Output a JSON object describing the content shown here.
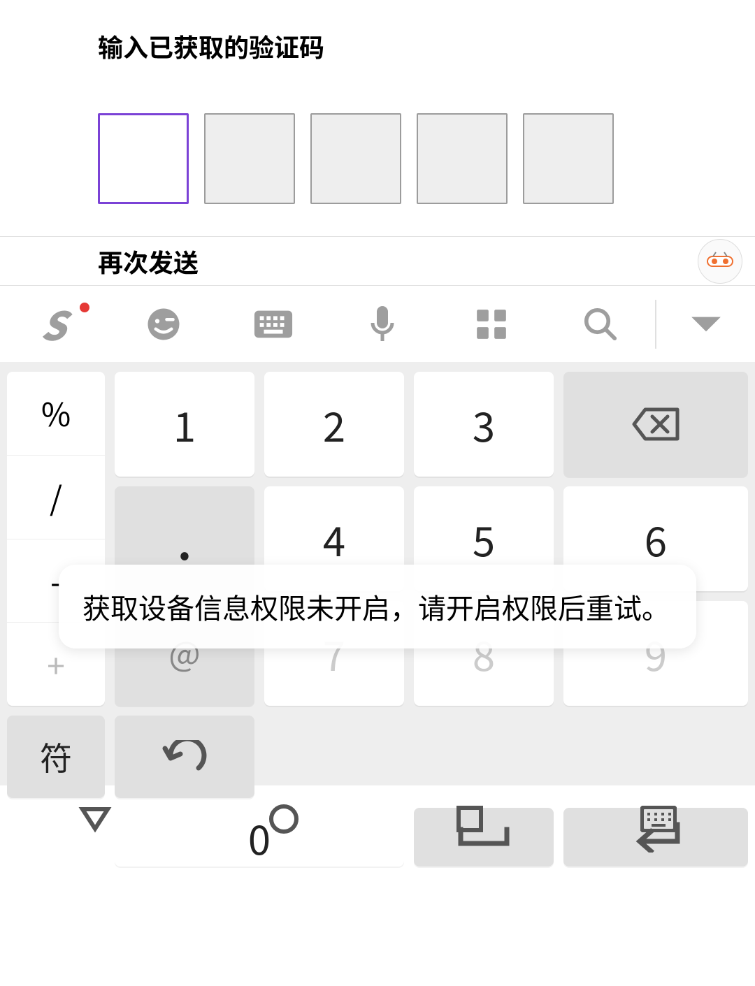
{
  "header": {
    "title": "输入已获取的验证码",
    "resend": "再次发送"
  },
  "code_inputs": {
    "count": 5,
    "active_index": 0,
    "values": [
      "",
      "",
      "",
      "",
      ""
    ]
  },
  "toast": {
    "message": "获取设备信息权限未开启，请开启权限后重试。"
  },
  "toolbar": {
    "logo": "S",
    "icons": {
      "emoji": "emoji-icon",
      "keyboard": "keyboard-switch-icon",
      "voice": "microphone-icon",
      "apps": "grid-icon",
      "search": "search-icon",
      "collapse": "chevron-down-icon"
    }
  },
  "keypad": {
    "side": [
      "%",
      "/",
      "-",
      "+"
    ],
    "row1": [
      "1",
      "2",
      "3"
    ],
    "row2": [
      "4",
      "5",
      "6"
    ],
    "row3": [
      "7",
      "8",
      "9"
    ],
    "backspace": "⌫",
    "dot": ".",
    "at": "@",
    "symbol_key": "符",
    "zero": "0",
    "undo": "undo-icon",
    "space": "space-icon",
    "enter": "enter-icon"
  },
  "nav": {
    "back": "back-icon",
    "home": "home-icon",
    "recent": "recent-icon",
    "ime": "ime-icon"
  }
}
